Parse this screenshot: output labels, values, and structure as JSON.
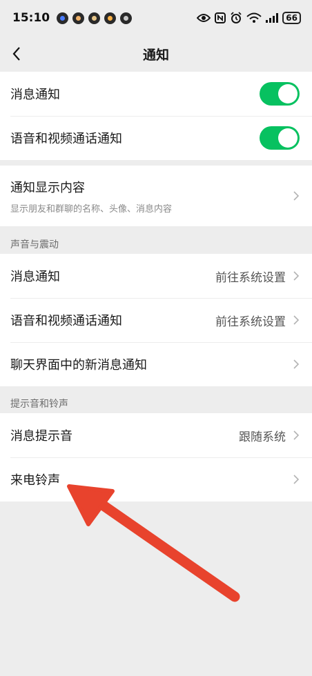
{
  "status_bar": {
    "time": "15:10",
    "battery": "66",
    "icons": [
      "eye-icon",
      "nfc-icon",
      "alarm-icon",
      "wifi-6-icon",
      "signal-icon"
    ]
  },
  "nav": {
    "title": "通知",
    "back_icon": "chevron-left-icon"
  },
  "group1": {
    "rows": [
      {
        "label": "消息通知",
        "toggle": "on"
      },
      {
        "label": "语音和视频通话通知",
        "toggle": "on"
      }
    ]
  },
  "group2": {
    "row": {
      "label": "通知显示内容",
      "sublabel": "显示朋友和群聊的名称、头像、消息内容"
    }
  },
  "section_sound": {
    "header": "声音与震动",
    "rows": [
      {
        "label": "消息通知",
        "value": "前往系统设置"
      },
      {
        "label": "语音和视频通话通知",
        "value": "前往系统设置"
      },
      {
        "label": "聊天界面中的新消息通知",
        "value": ""
      }
    ]
  },
  "section_ring": {
    "header": "提示音和铃声",
    "rows": [
      {
        "label": "消息提示音",
        "value": "跟随系统"
      },
      {
        "label": "来电铃声",
        "value": ""
      }
    ]
  },
  "colors": {
    "toggle_on": "#07c160",
    "annotation_arrow": "#e8432d",
    "background": "#ededed"
  }
}
